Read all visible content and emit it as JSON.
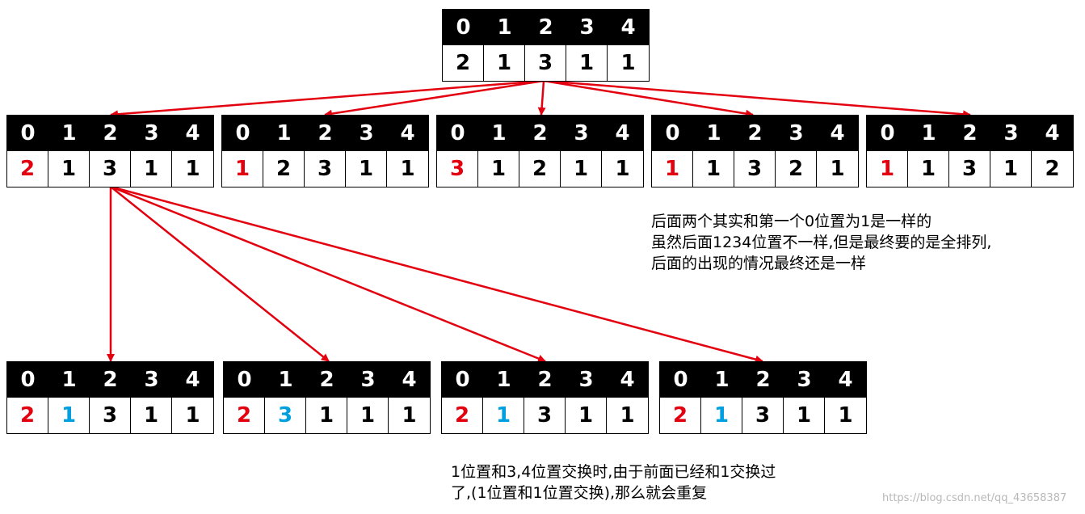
{
  "colors": {
    "red": "#e3000f",
    "blue": "#00a0e0",
    "black": "#000000",
    "arrow": "#e3000f"
  },
  "arrays": [
    {
      "id": "root",
      "indices": [
        "0",
        "1",
        "2",
        "3",
        "4"
      ],
      "values": [
        "2",
        "1",
        "3",
        "1",
        "1"
      ],
      "value_colors": [
        "black",
        "black",
        "black",
        "black",
        "black"
      ]
    },
    {
      "id": "level1-a",
      "indices": [
        "0",
        "1",
        "2",
        "3",
        "4"
      ],
      "values": [
        "2",
        "1",
        "3",
        "1",
        "1"
      ],
      "value_colors": [
        "red",
        "black",
        "black",
        "black",
        "black"
      ]
    },
    {
      "id": "level1-b",
      "indices": [
        "0",
        "1",
        "2",
        "3",
        "4"
      ],
      "values": [
        "1",
        "2",
        "3",
        "1",
        "1"
      ],
      "value_colors": [
        "red",
        "black",
        "black",
        "black",
        "black"
      ]
    },
    {
      "id": "level1-c",
      "indices": [
        "0",
        "1",
        "2",
        "3",
        "4"
      ],
      "values": [
        "3",
        "1",
        "2",
        "1",
        "1"
      ],
      "value_colors": [
        "red",
        "black",
        "black",
        "black",
        "black"
      ]
    },
    {
      "id": "level1-d",
      "indices": [
        "0",
        "1",
        "2",
        "3",
        "4"
      ],
      "values": [
        "1",
        "1",
        "3",
        "2",
        "1"
      ],
      "value_colors": [
        "red",
        "black",
        "black",
        "black",
        "black"
      ]
    },
    {
      "id": "level1-e",
      "indices": [
        "0",
        "1",
        "2",
        "3",
        "4"
      ],
      "values": [
        "1",
        "1",
        "3",
        "1",
        "2"
      ],
      "value_colors": [
        "red",
        "black",
        "black",
        "black",
        "black"
      ]
    },
    {
      "id": "level2-a",
      "indices": [
        "0",
        "1",
        "2",
        "3",
        "4"
      ],
      "values": [
        "2",
        "1",
        "3",
        "1",
        "1"
      ],
      "value_colors": [
        "red",
        "blue",
        "black",
        "black",
        "black"
      ]
    },
    {
      "id": "level2-b",
      "indices": [
        "0",
        "1",
        "2",
        "3",
        "4"
      ],
      "values": [
        "2",
        "3",
        "1",
        "1",
        "1"
      ],
      "value_colors": [
        "red",
        "blue",
        "black",
        "black",
        "black"
      ]
    },
    {
      "id": "level2-c",
      "indices": [
        "0",
        "1",
        "2",
        "3",
        "4"
      ],
      "values": [
        "2",
        "1",
        "3",
        "1",
        "1"
      ],
      "value_colors": [
        "red",
        "blue",
        "black",
        "black",
        "black"
      ]
    },
    {
      "id": "level2-d",
      "indices": [
        "0",
        "1",
        "2",
        "3",
        "4"
      ],
      "values": [
        "2",
        "1",
        "3",
        "1",
        "1"
      ],
      "value_colors": [
        "red",
        "blue",
        "black",
        "black",
        "black"
      ]
    }
  ],
  "notes": {
    "note1": [
      "后面两个其实和第一个0位置为1是一样的",
      "虽然后面1234位置不一样,但是最终要的是全排列,",
      "后面的出现的情况最终还是一样"
    ],
    "note2": [
      "1位置和3,4位置交换时,由于前面已经和1交换过",
      "了,(1位置和1位置交换),那么就会重复"
    ]
  },
  "watermark": "https://blog.csdn.net/qq_43658387"
}
